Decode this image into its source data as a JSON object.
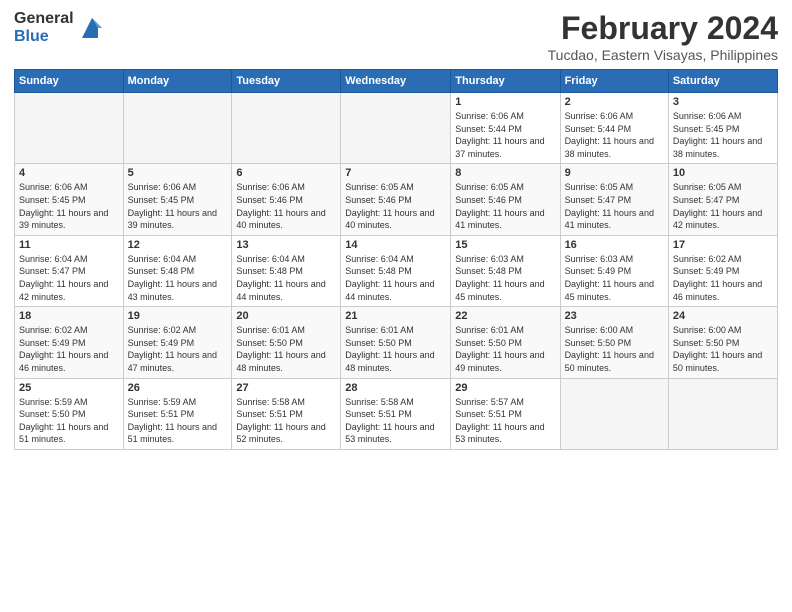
{
  "header": {
    "logo_general": "General",
    "logo_blue": "Blue",
    "title": "February 2024",
    "subtitle": "Tucdao, Eastern Visayas, Philippines"
  },
  "weekdays": [
    "Sunday",
    "Monday",
    "Tuesday",
    "Wednesday",
    "Thursday",
    "Friday",
    "Saturday"
  ],
  "weeks": [
    [
      {
        "num": "",
        "sunrise": "",
        "sunset": "",
        "daylight": ""
      },
      {
        "num": "",
        "sunrise": "",
        "sunset": "",
        "daylight": ""
      },
      {
        "num": "",
        "sunrise": "",
        "sunset": "",
        "daylight": ""
      },
      {
        "num": "",
        "sunrise": "",
        "sunset": "",
        "daylight": ""
      },
      {
        "num": "1",
        "sunrise": "Sunrise: 6:06 AM",
        "sunset": "Sunset: 5:44 PM",
        "daylight": "Daylight: 11 hours and 37 minutes."
      },
      {
        "num": "2",
        "sunrise": "Sunrise: 6:06 AM",
        "sunset": "Sunset: 5:44 PM",
        "daylight": "Daylight: 11 hours and 38 minutes."
      },
      {
        "num": "3",
        "sunrise": "Sunrise: 6:06 AM",
        "sunset": "Sunset: 5:45 PM",
        "daylight": "Daylight: 11 hours and 38 minutes."
      }
    ],
    [
      {
        "num": "4",
        "sunrise": "Sunrise: 6:06 AM",
        "sunset": "Sunset: 5:45 PM",
        "daylight": "Daylight: 11 hours and 39 minutes."
      },
      {
        "num": "5",
        "sunrise": "Sunrise: 6:06 AM",
        "sunset": "Sunset: 5:45 PM",
        "daylight": "Daylight: 11 hours and 39 minutes."
      },
      {
        "num": "6",
        "sunrise": "Sunrise: 6:06 AM",
        "sunset": "Sunset: 5:46 PM",
        "daylight": "Daylight: 11 hours and 40 minutes."
      },
      {
        "num": "7",
        "sunrise": "Sunrise: 6:05 AM",
        "sunset": "Sunset: 5:46 PM",
        "daylight": "Daylight: 11 hours and 40 minutes."
      },
      {
        "num": "8",
        "sunrise": "Sunrise: 6:05 AM",
        "sunset": "Sunset: 5:46 PM",
        "daylight": "Daylight: 11 hours and 41 minutes."
      },
      {
        "num": "9",
        "sunrise": "Sunrise: 6:05 AM",
        "sunset": "Sunset: 5:47 PM",
        "daylight": "Daylight: 11 hours and 41 minutes."
      },
      {
        "num": "10",
        "sunrise": "Sunrise: 6:05 AM",
        "sunset": "Sunset: 5:47 PM",
        "daylight": "Daylight: 11 hours and 42 minutes."
      }
    ],
    [
      {
        "num": "11",
        "sunrise": "Sunrise: 6:04 AM",
        "sunset": "Sunset: 5:47 PM",
        "daylight": "Daylight: 11 hours and 42 minutes."
      },
      {
        "num": "12",
        "sunrise": "Sunrise: 6:04 AM",
        "sunset": "Sunset: 5:48 PM",
        "daylight": "Daylight: 11 hours and 43 minutes."
      },
      {
        "num": "13",
        "sunrise": "Sunrise: 6:04 AM",
        "sunset": "Sunset: 5:48 PM",
        "daylight": "Daylight: 11 hours and 44 minutes."
      },
      {
        "num": "14",
        "sunrise": "Sunrise: 6:04 AM",
        "sunset": "Sunset: 5:48 PM",
        "daylight": "Daylight: 11 hours and 44 minutes."
      },
      {
        "num": "15",
        "sunrise": "Sunrise: 6:03 AM",
        "sunset": "Sunset: 5:48 PM",
        "daylight": "Daylight: 11 hours and 45 minutes."
      },
      {
        "num": "16",
        "sunrise": "Sunrise: 6:03 AM",
        "sunset": "Sunset: 5:49 PM",
        "daylight": "Daylight: 11 hours and 45 minutes."
      },
      {
        "num": "17",
        "sunrise": "Sunrise: 6:02 AM",
        "sunset": "Sunset: 5:49 PM",
        "daylight": "Daylight: 11 hours and 46 minutes."
      }
    ],
    [
      {
        "num": "18",
        "sunrise": "Sunrise: 6:02 AM",
        "sunset": "Sunset: 5:49 PM",
        "daylight": "Daylight: 11 hours and 46 minutes."
      },
      {
        "num": "19",
        "sunrise": "Sunrise: 6:02 AM",
        "sunset": "Sunset: 5:49 PM",
        "daylight": "Daylight: 11 hours and 47 minutes."
      },
      {
        "num": "20",
        "sunrise": "Sunrise: 6:01 AM",
        "sunset": "Sunset: 5:50 PM",
        "daylight": "Daylight: 11 hours and 48 minutes."
      },
      {
        "num": "21",
        "sunrise": "Sunrise: 6:01 AM",
        "sunset": "Sunset: 5:50 PM",
        "daylight": "Daylight: 11 hours and 48 minutes."
      },
      {
        "num": "22",
        "sunrise": "Sunrise: 6:01 AM",
        "sunset": "Sunset: 5:50 PM",
        "daylight": "Daylight: 11 hours and 49 minutes."
      },
      {
        "num": "23",
        "sunrise": "Sunrise: 6:00 AM",
        "sunset": "Sunset: 5:50 PM",
        "daylight": "Daylight: 11 hours and 50 minutes."
      },
      {
        "num": "24",
        "sunrise": "Sunrise: 6:00 AM",
        "sunset": "Sunset: 5:50 PM",
        "daylight": "Daylight: 11 hours and 50 minutes."
      }
    ],
    [
      {
        "num": "25",
        "sunrise": "Sunrise: 5:59 AM",
        "sunset": "Sunset: 5:50 PM",
        "daylight": "Daylight: 11 hours and 51 minutes."
      },
      {
        "num": "26",
        "sunrise": "Sunrise: 5:59 AM",
        "sunset": "Sunset: 5:51 PM",
        "daylight": "Daylight: 11 hours and 51 minutes."
      },
      {
        "num": "27",
        "sunrise": "Sunrise: 5:58 AM",
        "sunset": "Sunset: 5:51 PM",
        "daylight": "Daylight: 11 hours and 52 minutes."
      },
      {
        "num": "28",
        "sunrise": "Sunrise: 5:58 AM",
        "sunset": "Sunset: 5:51 PM",
        "daylight": "Daylight: 11 hours and 53 minutes."
      },
      {
        "num": "29",
        "sunrise": "Sunrise: 5:57 AM",
        "sunset": "Sunset: 5:51 PM",
        "daylight": "Daylight: 11 hours and 53 minutes."
      },
      {
        "num": "",
        "sunrise": "",
        "sunset": "",
        "daylight": ""
      },
      {
        "num": "",
        "sunrise": "",
        "sunset": "",
        "daylight": ""
      }
    ]
  ]
}
